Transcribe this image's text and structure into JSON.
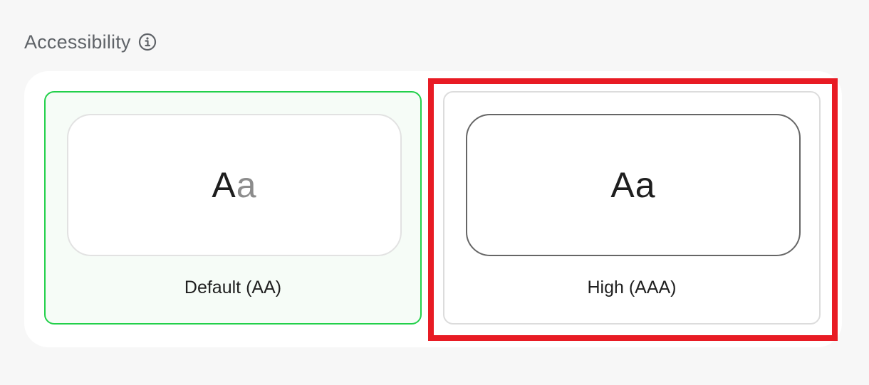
{
  "section": {
    "title": "Accessibility",
    "info_icon": "info-circle-icon"
  },
  "options": [
    {
      "label": "Default (AA)",
      "preview_upper": "A",
      "preview_lower": "a",
      "selected": true
    },
    {
      "label": "High (AAA)",
      "preview_upper": "A",
      "preview_lower": "a",
      "selected": false
    }
  ],
  "colors": {
    "selected_border": "#22d04a",
    "selected_background": "#f6fcf7",
    "highlight_outline": "#e81b24",
    "default_preview_lowercase": "#8c8c8c",
    "high_preview_lowercase": "#1e1e1e"
  }
}
